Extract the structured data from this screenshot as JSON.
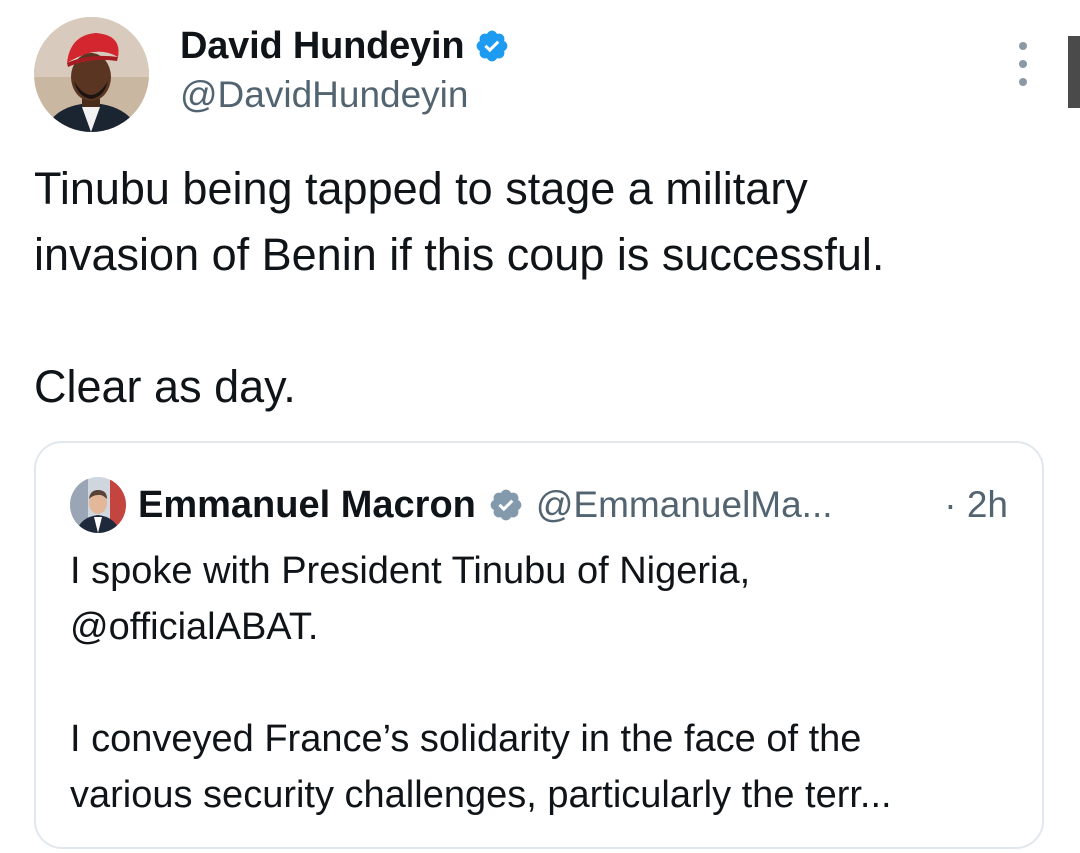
{
  "author": {
    "name": "David Hundeyin",
    "handle": "@DavidHundeyin",
    "verified_color": "#1d9bf0",
    "avatar": "avatar-photo-red-cap"
  },
  "tweet": {
    "line1": "Tinubu being tapped to stage a military",
    "line2": "invasion of Benin if this coup is successful.",
    "line3": "Clear as day."
  },
  "quoted": {
    "name": "Emmanuel Macron",
    "handle": "@EmmanuelMa...",
    "time": "· 2h",
    "verified_color": "#829aab",
    "avatar": "avatar-photo-suit",
    "line1": "I spoke with President Tinubu of Nigeria,",
    "line2": "@officialABAT.",
    "line3": "I conveyed France’s solidarity in the face of the",
    "line4": "various security challenges, particularly the terr..."
  },
  "icons": {
    "more": "more-vertical-icon",
    "verified": "verified-badge-icon"
  }
}
